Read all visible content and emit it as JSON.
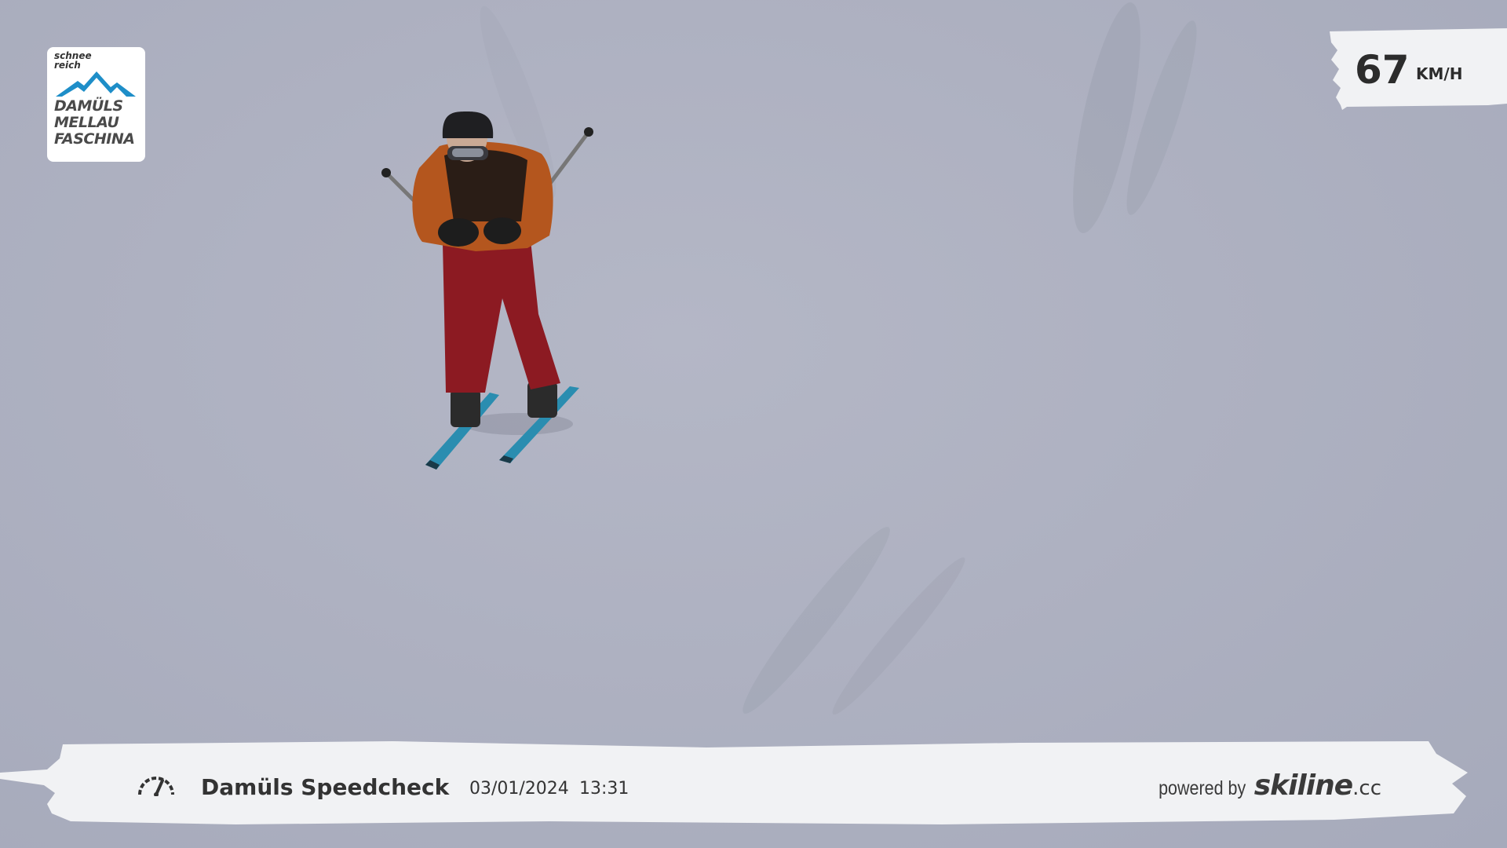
{
  "logo": {
    "line1": "schnee",
    "line2": "reich",
    "resort_lines": [
      "DAMÜLS",
      "MELLAU",
      "FASCHINA"
    ],
    "mountain_color": "#1e8ec8"
  },
  "speed": {
    "value": "67",
    "unit": "KM/H"
  },
  "banner": {
    "icon": "speedometer-icon",
    "title": "Damüls Speedcheck",
    "date": "03/01/2024",
    "time": "13:31",
    "powered_by": "powered by",
    "brand": "skiline",
    "brand_tld": ".cc"
  },
  "colors": {
    "snow": "#aeb1c1",
    "jacket_orange": "#b4561e",
    "pants_red": "#8c1a22",
    "ski_blue": "#2a8db0",
    "badge_white": "#f1f2f4"
  }
}
